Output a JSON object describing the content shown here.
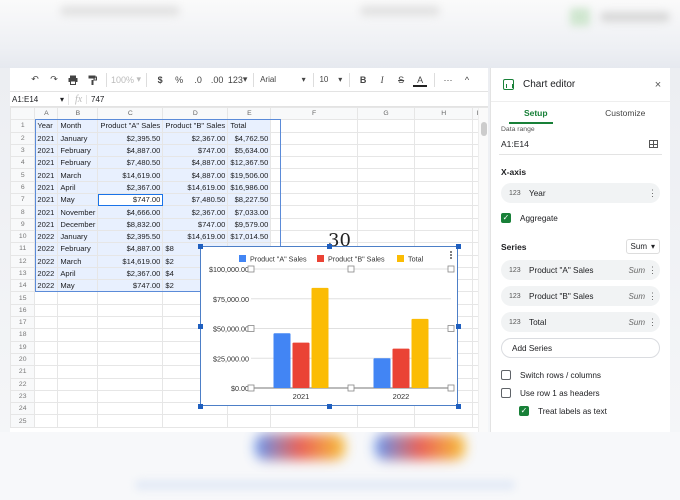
{
  "overlay_number": "30",
  "toolbar": {
    "undo": "↶",
    "redo": "↷",
    "print": "🖶",
    "paint_format": "paint-format",
    "zoom": "100%",
    "currency": "$",
    "percent": "%",
    "dec_decrease": ".0",
    "dec_increase": ".00",
    "more_formats": "123",
    "font": "Arial",
    "font_size": "10",
    "bold": "B",
    "italic": "I",
    "strike": "S",
    "text_color": "A",
    "more": "···",
    "collapse": "^"
  },
  "formula_bar": {
    "name_box": "A1:E14",
    "fx": "fx",
    "value": "747"
  },
  "columns": [
    "A",
    "B",
    "C",
    "D",
    "E",
    "F",
    "G",
    "H",
    "I"
  ],
  "rows": [
    {
      "n": "1",
      "cells": [
        "Year",
        "Month",
        "Product \"A\" Sales",
        "Product \"B\" Sales",
        "Total"
      ]
    },
    {
      "n": "2",
      "cells": [
        "2021",
        "January",
        "$2,395.50",
        "$2,367.00",
        "$4,762.50"
      ]
    },
    {
      "n": "3",
      "cells": [
        "2021",
        "February",
        "$4,887.00",
        "$747.00",
        "$5,634.00"
      ]
    },
    {
      "n": "4",
      "cells": [
        "2021",
        "February",
        "$7,480.50",
        "$4,887.00",
        "$12,367.50"
      ]
    },
    {
      "n": "5",
      "cells": [
        "2021",
        "March",
        "$14,619.00",
        "$4,887.00",
        "$19,506.00"
      ]
    },
    {
      "n": "6",
      "cells": [
        "2021",
        "April",
        "$2,367.00",
        "$14,619.00",
        "$16,986.00"
      ]
    },
    {
      "n": "7",
      "cells": [
        "2021",
        "May",
        "$747.00",
        "$7,480.50",
        "$8,227.50"
      ]
    },
    {
      "n": "8",
      "cells": [
        "2021",
        "November",
        "$4,666.00",
        "$2,367.00",
        "$7,033.00"
      ]
    },
    {
      "n": "9",
      "cells": [
        "2021",
        "December",
        "$8,832.00",
        "$747.00",
        "$9,579.00"
      ]
    },
    {
      "n": "10",
      "cells": [
        "2022",
        "January",
        "$2,395.50",
        "$14,619.00",
        "$17,014.50"
      ]
    },
    {
      "n": "11",
      "cells": [
        "2022",
        "February",
        "$4,887.00",
        "$8",
        ""
      ]
    },
    {
      "n": "12",
      "cells": [
        "2022",
        "March",
        "$14,619.00",
        "$2",
        ""
      ]
    },
    {
      "n": "13",
      "cells": [
        "2022",
        "April",
        "$2,367.00",
        "$4",
        ""
      ]
    },
    {
      "n": "14",
      "cells": [
        "2022",
        "May",
        "$747.00",
        "$2",
        ""
      ]
    },
    {
      "n": "15",
      "cells": [
        "",
        "",
        "",
        "",
        ""
      ]
    },
    {
      "n": "16",
      "cells": [
        "",
        "",
        "",
        "",
        ""
      ]
    },
    {
      "n": "17",
      "cells": [
        "",
        "",
        "",
        "",
        ""
      ]
    },
    {
      "n": "18",
      "cells": [
        "",
        "",
        "",
        "",
        ""
      ]
    },
    {
      "n": "19",
      "cells": [
        "",
        "",
        "",
        "",
        ""
      ]
    },
    {
      "n": "20",
      "cells": [
        "",
        "",
        "",
        "",
        ""
      ]
    },
    {
      "n": "21",
      "cells": [
        "",
        "",
        "",
        "",
        ""
      ]
    },
    {
      "n": "22",
      "cells": [
        "",
        "",
        "",
        "",
        ""
      ]
    },
    {
      "n": "23",
      "cells": [
        "",
        "",
        "",
        "",
        ""
      ]
    },
    {
      "n": "24",
      "cells": [
        "",
        "",
        "",
        "",
        ""
      ]
    },
    {
      "n": "25",
      "cells": [
        "",
        "",
        "",
        "",
        ""
      ]
    }
  ],
  "chart_data": {
    "type": "bar",
    "title": "",
    "categories": [
      "2021",
      "2022"
    ],
    "series": [
      {
        "name": "Product \"A\" Sales",
        "color": "#4285f4",
        "values": [
          45994,
          25015.5
        ]
      },
      {
        "name": "Product \"B\" Sales",
        "color": "#ea4335",
        "values": [
          38101.5,
          33072
        ]
      },
      {
        "name": "Total",
        "color": "#fbbc04",
        "values": [
          84095.5,
          58087.5
        ]
      }
    ],
    "yticks": [
      "$0.00",
      "$25,000.00",
      "$50,000.00",
      "$75,000.00",
      "$100,000.00"
    ],
    "ylim": [
      0,
      100000
    ],
    "xlabel": "",
    "ylabel": "",
    "legend": "top",
    "grid": true
  },
  "editor": {
    "title": "Chart editor",
    "close": "×",
    "tabs": [
      {
        "label": "Setup",
        "active": true
      },
      {
        "label": "Customize",
        "active": false
      }
    ],
    "data_range_label": "Data range",
    "data_range": "A1:E14",
    "xaxis_title": "X-axis",
    "xaxis_type": "123",
    "xaxis_field": "Year",
    "aggregate_label": "Aggregate",
    "aggregate_checked": true,
    "series_title": "Series",
    "series_agg": "Sum",
    "series": [
      {
        "type": "123",
        "label": "Product \"A\" Sales",
        "agg": "Sum"
      },
      {
        "type": "123",
        "label": "Product \"B\" Sales",
        "agg": "Sum"
      },
      {
        "type": "123",
        "label": "Total",
        "agg": "Sum"
      }
    ],
    "add_series": "Add Series",
    "options": [
      {
        "label": "Switch rows / columns",
        "checked": false
      },
      {
        "label": "Use row 1 as headers",
        "checked": false
      },
      {
        "label": "Treat labels as text",
        "checked": true
      }
    ],
    "colors": {
      "accent": "#188038",
      "selection": "#1a73e8"
    }
  }
}
